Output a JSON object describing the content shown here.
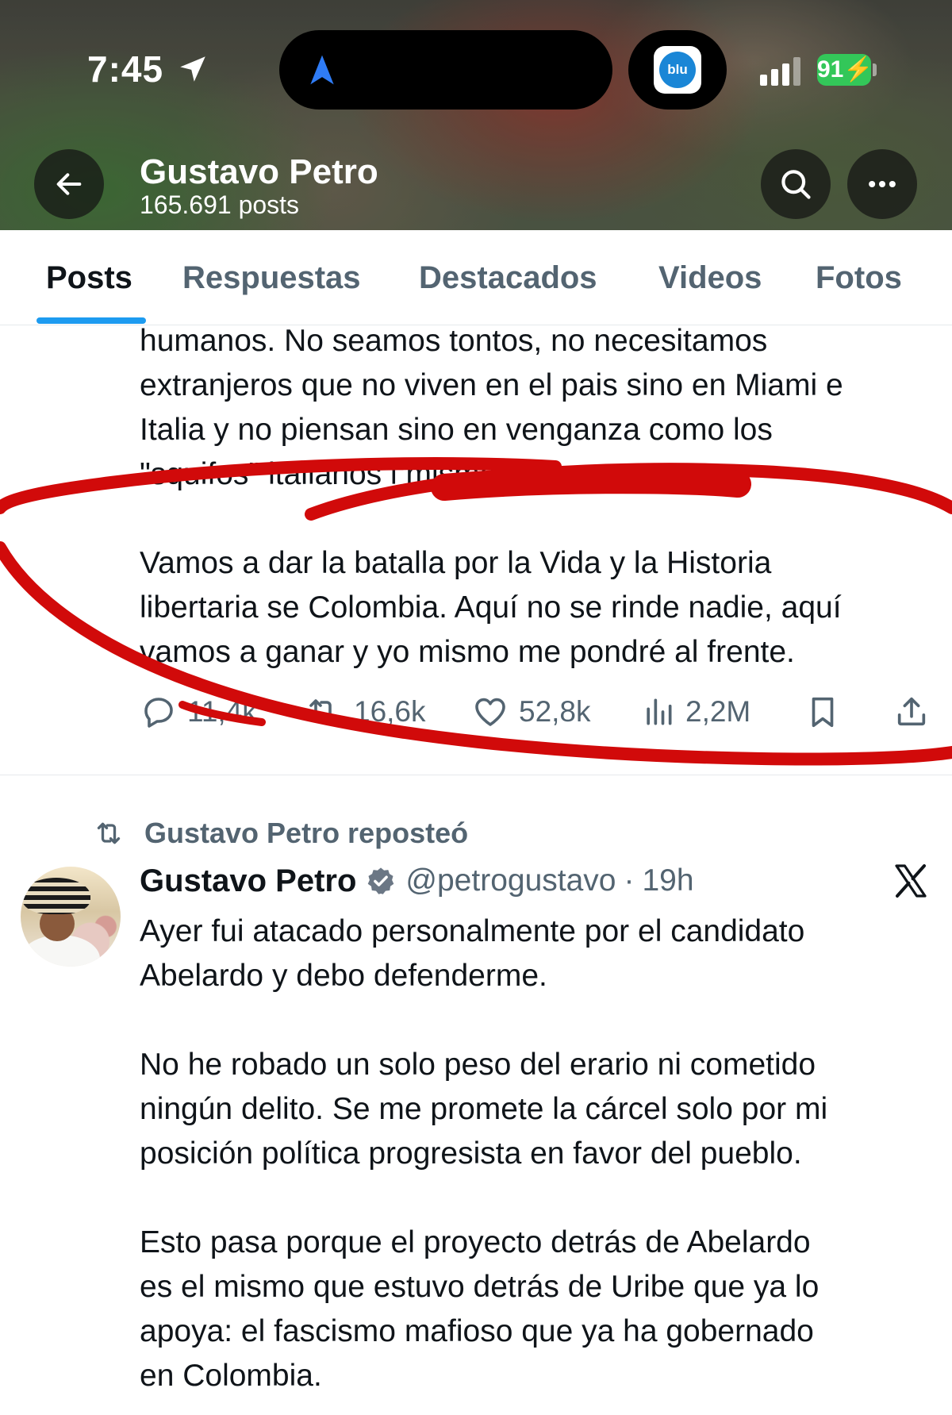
{
  "status_bar": {
    "time": "7:45",
    "battery": "91",
    "island_app_label": "blu",
    "icons": [
      "location-arrow-icon",
      "navigation-icon",
      "blu-radio-app-icon",
      "signal-icon",
      "battery-icon"
    ]
  },
  "profile": {
    "name": "Gustavo Petro",
    "posts_count": "165.691 posts"
  },
  "tabs": [
    {
      "label": "Posts",
      "active": true
    },
    {
      "label": "Respuestas",
      "active": false
    },
    {
      "label": "Destacados",
      "active": false
    },
    {
      "label": "Videos",
      "active": false
    },
    {
      "label": "Fotos",
      "active": false
    }
  ],
  "tweet1": {
    "lines": [
      "humanos. No seamos tontos, no necesitamos",
      "extranjeros que no viven en el pais sino en Miami e",
      "Italia y no piensan sino en venganza como los",
      "\"squifos\" italianos                                        i mismos.",
      "Vamos a dar la batalla por la Vida y la Historia",
      "libertaria se Colombia. Aquí no se rinde nadie, aquí",
      "vamos a ganar y yo mismo me pondré al frente."
    ],
    "actions": {
      "replies": "11,4k",
      "reposts": "16,6k",
      "likes": "52,8k",
      "views": "2,2M"
    }
  },
  "tweet2": {
    "repost_label": "Gustavo Petro reposteó",
    "author_name": "Gustavo Petro",
    "handle": "@petrogustavo",
    "separator": "·",
    "time": "19h",
    "lines": [
      "Ayer fui atacado personalmente por el candidato",
      "Abelardo y debo defenderme.",
      "No he robado un solo peso del erario ni cometido",
      "ningún delito. Se me promete la cárcel solo por mi",
      "posición política progresista en favor del pueblo.",
      "Esto pasa porque el proyecto detrás de Abelardo",
      "es el mismo que estuvo detrás de Uribe que ya lo",
      "apoya: el fascismo mafioso que ya ha gobernado",
      "en Colombia."
    ]
  },
  "colors": {
    "accent": "#1d9bf0",
    "annotation_red": "#d10a0a",
    "text_primary": "#0f1419",
    "text_secondary": "#536471",
    "battery_green": "#33c759"
  }
}
